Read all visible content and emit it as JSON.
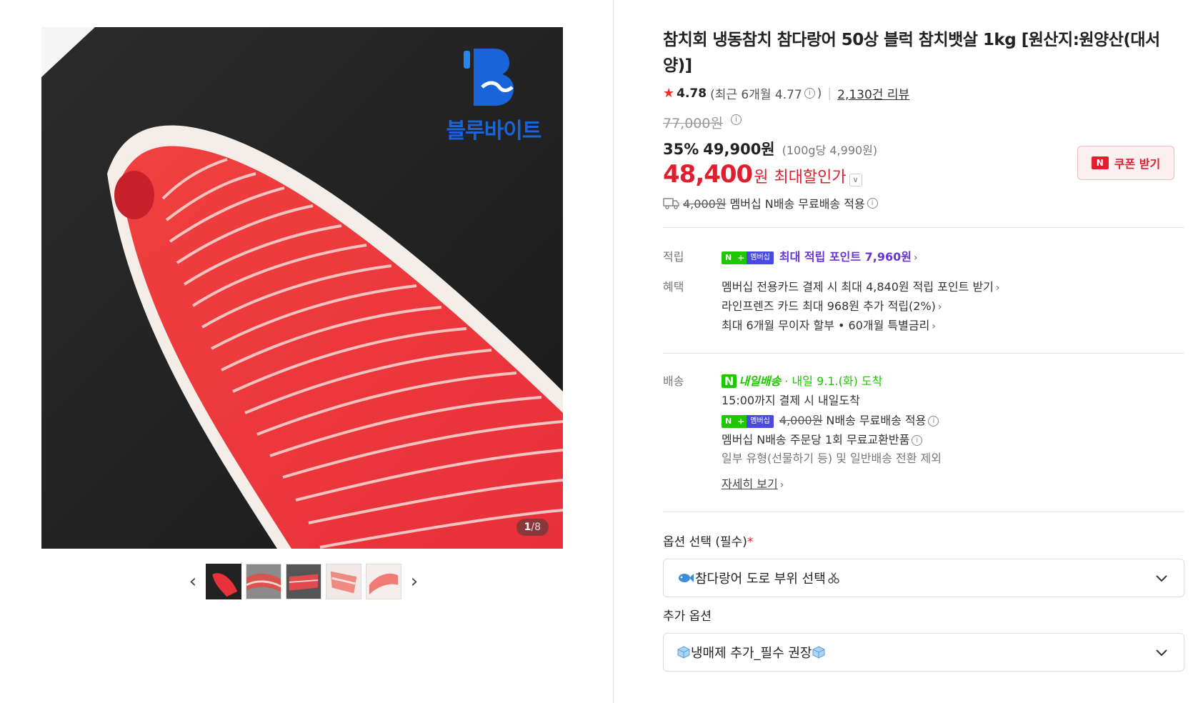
{
  "gallery": {
    "brand_name": "블루바이트",
    "current_page": "1",
    "total_pages": "/8",
    "prev_label": "‹",
    "next_label": "›"
  },
  "product": {
    "title": "참치회 냉동참치 참다랑어 50상 블럭 참치뱃살 1kg [원산지:원양산(대서양)]",
    "rating": "4.78",
    "rating_recent": "(최근 6개월 4.77",
    "rating_recent_close": ")",
    "review_count": "2,130건 리뷰",
    "original_price": "77,000원",
    "discount_rate": "35%",
    "sale_price": "49,900원",
    "unit_price": "(100g당 4,990원)",
    "max_discount_price": "48,400",
    "max_discount_won": "원",
    "max_discount_label": "최대할인가",
    "coupon_label": "쿠폰 받기",
    "shipping_strike": "4,000원",
    "shipping_text": "멤버십 N배송 무료배송 적용"
  },
  "benefits": {
    "points_label": "적립",
    "points_text": "최대 적립 포인트 7,960원",
    "benefit_label": "혜택",
    "benefit_items": [
      "멤버십 전용카드 결제 시 최대 4,840원 적립 포인트 받기",
      "라인프렌즈 카드 최대 968원 추가 적립(2%)",
      "최대 6개월 무이자 할부 • 60개월 특별금리"
    ]
  },
  "delivery": {
    "label": "배송",
    "badge": "내일배송",
    "arrival": "· 내일 9.1.(화) 도착",
    "cutoff": "15:00까지 결제 시 내일도착",
    "fee_strike": "4,000원",
    "fee_text": "N배송 무료배송 적용",
    "exchange": "멤버십 N배송 주문당 1회 무료교환반품",
    "exclude": "일부 유형(선물하기 등) 및 일반배송 전환 제외",
    "details_link": "자세히 보기"
  },
  "options": {
    "required_label": "옵션 선택 (필수)",
    "required_mark": "*",
    "required_value": "참다랑어 도로 부위 선택",
    "extra_label": "추가 옵션",
    "extra_value": "냉매제 추가_필수 권장"
  },
  "badges": {
    "n": "N",
    "plus": "+",
    "membership": "멤버십"
  },
  "colors": {
    "accent_red": "#e01e2e",
    "naver_green": "#1ec800",
    "brand_blue": "#1a64d9",
    "purple": "#6a35d8"
  }
}
